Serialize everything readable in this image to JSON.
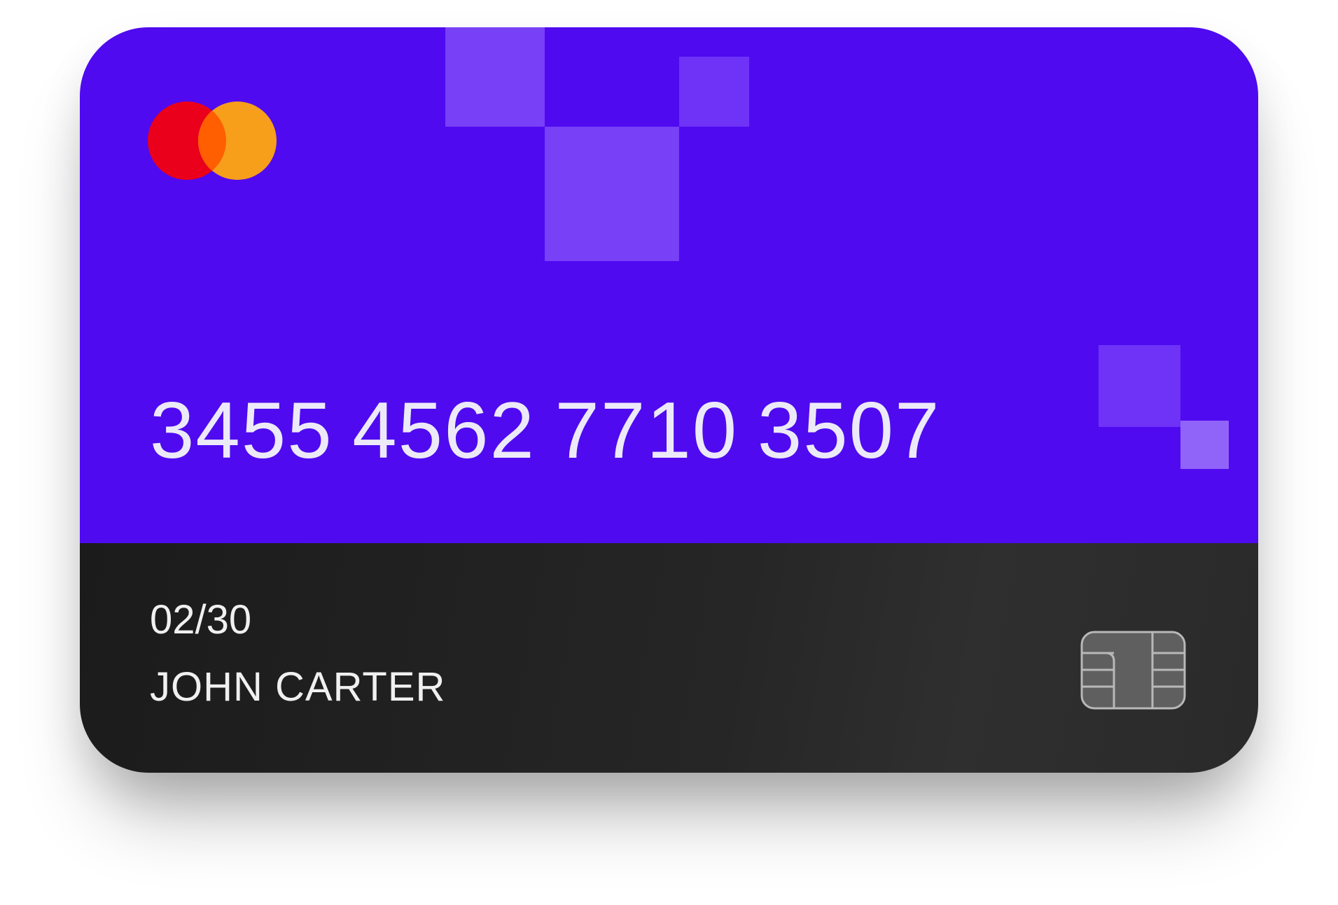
{
  "colors": {
    "primary": "#4f0af0",
    "bottom_band": "#1f1f1f",
    "text": "#eceaf8",
    "mastercard_red": "#eb001b",
    "mastercard_orange": "#f79e1b",
    "mastercard_overlap": "#ff5f00"
  },
  "card": {
    "brand_icon": "mastercard-logo-icon",
    "number": "3455 4562 7710 3507",
    "expiry": "02/30",
    "holder": "JOHN CARTER",
    "chip_icon": "emv-chip-icon"
  }
}
